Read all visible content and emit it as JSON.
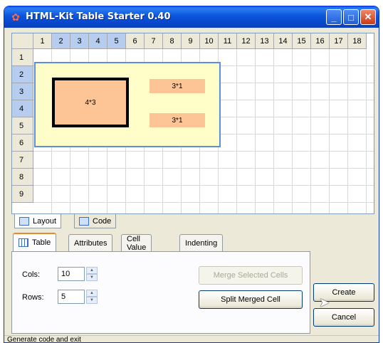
{
  "window": {
    "title": "HTML-Kit Table Starter 0.40"
  },
  "grid": {
    "columns": [
      "1",
      "2",
      "3",
      "4",
      "5",
      "6",
      "7",
      "8",
      "9",
      "10",
      "11",
      "12",
      "13",
      "14",
      "15",
      "16",
      "17",
      "18"
    ],
    "selected_columns": [
      "2",
      "3",
      "4",
      "5"
    ],
    "rows": [
      "1",
      "2",
      "3",
      "4",
      "5",
      "6",
      "7",
      "8",
      "9"
    ],
    "selected_rows": [
      "2",
      "3",
      "4"
    ],
    "merged_cells": [
      {
        "label": "4*3"
      },
      {
        "label": "3*1"
      },
      {
        "label": "3*1"
      }
    ]
  },
  "view_tabs": [
    {
      "label": "Layout",
      "active": true
    },
    {
      "label": "Code",
      "active": false
    }
  ],
  "prop_tabs": [
    {
      "label": "Table",
      "active": true
    },
    {
      "label": "Attributes",
      "active": false
    },
    {
      "label": "Cell Value",
      "active": false
    },
    {
      "label": "Indenting",
      "active": false
    }
  ],
  "fields": {
    "cols_label": "Cols:",
    "cols_value": "10",
    "rows_label": "Rows:",
    "rows_value": "5"
  },
  "buttons": {
    "merge": "Merge Selected Cells",
    "split": "Split Merged Cell",
    "create": "Create",
    "cancel": "Cancel"
  },
  "status": "Generate code and exit",
  "colors": {
    "title_bar": "#0b54dc",
    "selection": "#b6cdf0",
    "table_bg": "#fffdc8",
    "merged_cell": "#fdc596"
  }
}
